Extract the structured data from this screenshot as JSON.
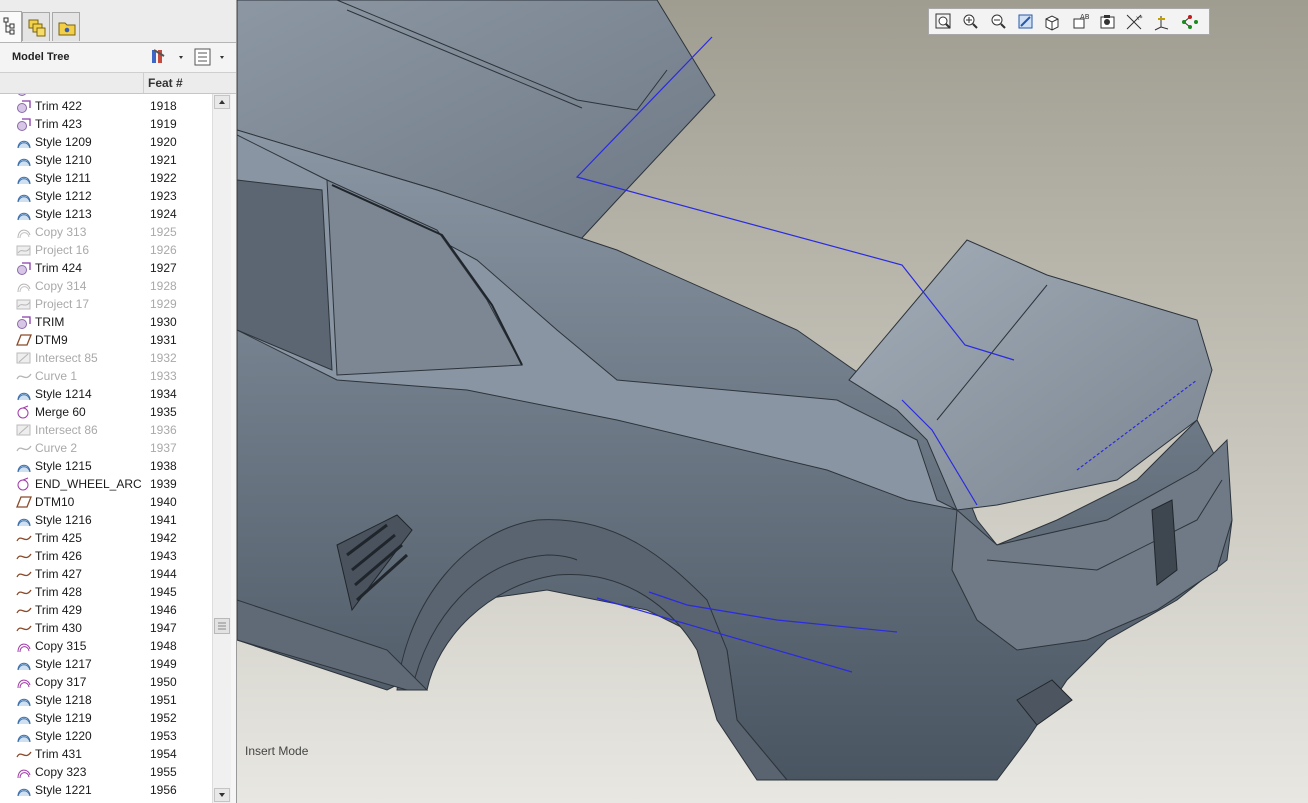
{
  "tabs": [
    {
      "name": "model-tree-tab",
      "icon": "model-tree-icon"
    },
    {
      "name": "layers-tab",
      "icon": "layers-icon"
    },
    {
      "name": "folder-browser-tab",
      "icon": "folder-browser-icon"
    }
  ],
  "model_tree": {
    "title": "Model Tree",
    "settings_icon": "tree-settings-icon",
    "columns_icon": "tree-columns-icon",
    "column_feat": "Feat #"
  },
  "tree_rows": [
    {
      "name": "Trim 422",
      "feat": "1918",
      "icon": "trim",
      "dim": false
    },
    {
      "name": "Trim 423",
      "feat": "1919",
      "icon": "trim",
      "dim": false
    },
    {
      "name": "Style 1209",
      "feat": "1920",
      "icon": "style",
      "dim": false
    },
    {
      "name": "Style 1210",
      "feat": "1921",
      "icon": "style",
      "dim": false
    },
    {
      "name": "Style 1211",
      "feat": "1922",
      "icon": "style",
      "dim": false
    },
    {
      "name": "Style 1212",
      "feat": "1923",
      "icon": "style",
      "dim": false
    },
    {
      "name": "Style 1213",
      "feat": "1924",
      "icon": "style",
      "dim": false
    },
    {
      "name": "Copy 313",
      "feat": "1925",
      "icon": "copy",
      "dim": true
    },
    {
      "name": "Project 16",
      "feat": "1926",
      "icon": "project",
      "dim": true
    },
    {
      "name": "Trim 424",
      "feat": "1927",
      "icon": "trim",
      "dim": false
    },
    {
      "name": "Copy 314",
      "feat": "1928",
      "icon": "copy",
      "dim": true
    },
    {
      "name": "Project 17",
      "feat": "1929",
      "icon": "project",
      "dim": true
    },
    {
      "name": "TRIM",
      "feat": "1930",
      "icon": "trim",
      "dim": false
    },
    {
      "name": "DTM9",
      "feat": "1931",
      "icon": "datum",
      "dim": false
    },
    {
      "name": "Intersect 85",
      "feat": "1932",
      "icon": "intersect",
      "dim": true
    },
    {
      "name": "Curve 1",
      "feat": "1933",
      "icon": "curve",
      "dim": true
    },
    {
      "name": "Style 1214",
      "feat": "1934",
      "icon": "style",
      "dim": false
    },
    {
      "name": "Merge 60",
      "feat": "1935",
      "icon": "merge",
      "dim": false
    },
    {
      "name": "Intersect 86",
      "feat": "1936",
      "icon": "intersect",
      "dim": true
    },
    {
      "name": "Curve 2",
      "feat": "1937",
      "icon": "curve",
      "dim": true
    },
    {
      "name": "Style 1215",
      "feat": "1938",
      "icon": "style",
      "dim": false
    },
    {
      "name": "END_WHEEL_ARC",
      "feat": "1939",
      "icon": "merge",
      "dim": false
    },
    {
      "name": "DTM10",
      "feat": "1940",
      "icon": "datum",
      "dim": false
    },
    {
      "name": "Style 1216",
      "feat": "1941",
      "icon": "style",
      "dim": false
    },
    {
      "name": "Trim 425",
      "feat": "1942",
      "icon": "curve-trim",
      "dim": false
    },
    {
      "name": "Trim 426",
      "feat": "1943",
      "icon": "curve-trim",
      "dim": false
    },
    {
      "name": "Trim 427",
      "feat": "1944",
      "icon": "curve-trim",
      "dim": false
    },
    {
      "name": "Trim 428",
      "feat": "1945",
      "icon": "curve-trim",
      "dim": false
    },
    {
      "name": "Trim 429",
      "feat": "1946",
      "icon": "curve-trim",
      "dim": false
    },
    {
      "name": "Trim 430",
      "feat": "1947",
      "icon": "curve-trim",
      "dim": false
    },
    {
      "name": "Copy 315",
      "feat": "1948",
      "icon": "copy-active",
      "dim": false
    },
    {
      "name": "Style 1217",
      "feat": "1949",
      "icon": "style",
      "dim": false
    },
    {
      "name": "Copy 317",
      "feat": "1950",
      "icon": "copy-active",
      "dim": false
    },
    {
      "name": "Style 1218",
      "feat": "1951",
      "icon": "style",
      "dim": false
    },
    {
      "name": "Style 1219",
      "feat": "1952",
      "icon": "style",
      "dim": false
    },
    {
      "name": "Style 1220",
      "feat": "1953",
      "icon": "style",
      "dim": false
    },
    {
      "name": "Trim 431",
      "feat": "1954",
      "icon": "curve-trim",
      "dim": false
    },
    {
      "name": "Copy 323",
      "feat": "1955",
      "icon": "copy-active",
      "dim": false
    },
    {
      "name": "Style 1221",
      "feat": "1956",
      "icon": "style",
      "dim": false
    }
  ],
  "view_toolbar": [
    "zoom-fit-icon",
    "zoom-in-icon",
    "zoom-out-icon",
    "repaint-icon",
    "saved-views-icon",
    "annotation-display-icon",
    "spin-center-icon",
    "datum-display-icon",
    "csys-display-icon",
    "point-display-icon"
  ],
  "status": {
    "mode": "Insert Mode"
  },
  "colors": {
    "model_surface": "#7f8a96",
    "curve_blue": "#2a2ae0",
    "background_top": "#9f9c90",
    "background_bottom": "#e8e7e2"
  }
}
